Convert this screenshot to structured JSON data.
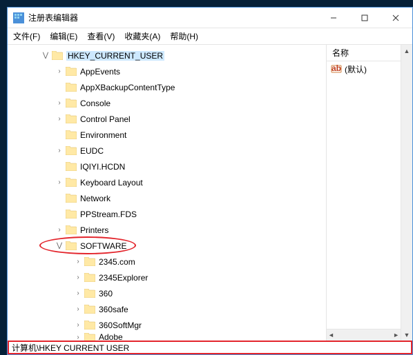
{
  "window": {
    "title": "注册表编辑器"
  },
  "menu": {
    "file": "文件(F)",
    "edit": "编辑(E)",
    "view": "查看(V)",
    "favorites": "收藏夹(A)",
    "help": "帮助(H)"
  },
  "tree": {
    "root": {
      "label": "HKEY_CURRENT_USER",
      "indent": 48,
      "expander": "⋁",
      "selected": true
    },
    "children": [
      {
        "label": "AppEvents",
        "indent": 68,
        "expander": "›"
      },
      {
        "label": "AppXBackupContentType",
        "indent": 68,
        "expander": ""
      },
      {
        "label": "Console",
        "indent": 68,
        "expander": "›"
      },
      {
        "label": "Control Panel",
        "indent": 68,
        "expander": "›"
      },
      {
        "label": "Environment",
        "indent": 68,
        "expander": ""
      },
      {
        "label": "EUDC",
        "indent": 68,
        "expander": "›"
      },
      {
        "label": "IQIYI.HCDN",
        "indent": 68,
        "expander": ""
      },
      {
        "label": "Keyboard Layout",
        "indent": 68,
        "expander": "›"
      },
      {
        "label": "Network",
        "indent": 68,
        "expander": ""
      },
      {
        "label": "PPStream.FDS",
        "indent": 68,
        "expander": ""
      },
      {
        "label": "Printers",
        "indent": 68,
        "expander": "›"
      },
      {
        "label": "SOFTWARE",
        "indent": 68,
        "expander": "⋁",
        "circled": true
      },
      {
        "label": "2345.com",
        "indent": 95,
        "expander": "›"
      },
      {
        "label": "2345Explorer",
        "indent": 95,
        "expander": "›"
      },
      {
        "label": "360",
        "indent": 95,
        "expander": "›"
      },
      {
        "label": "360safe",
        "indent": 95,
        "expander": "›"
      },
      {
        "label": "360SoftMgr",
        "indent": 95,
        "expander": "›"
      },
      {
        "label": "Adobe",
        "indent": 95,
        "expander": "›",
        "cut": true
      }
    ]
  },
  "list": {
    "header": {
      "name": "名称"
    },
    "rows": [
      {
        "label": "(默认)"
      }
    ]
  },
  "statusbar": {
    "path": "计算机\\HKEY CURRENT USER"
  }
}
